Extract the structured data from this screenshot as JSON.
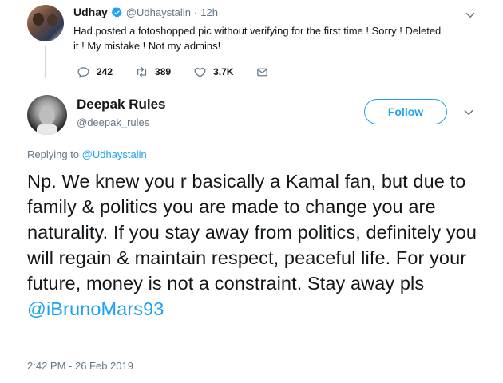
{
  "parent_tweet": {
    "name": "Udhay",
    "handle": "@Udhaystalin",
    "separator": "·",
    "time": "12h",
    "text": "Had posted a fotoshopped pic without verifying for the first time ! Sorry ! Deleted it ! My mistake ! Not my admins!",
    "replies": "242",
    "retweets": "389",
    "likes": "3.7K",
    "icons": [
      "reply-icon",
      "retweet-icon",
      "like-icon",
      "direct-message-icon",
      "verified-badge-icon",
      "chevron-down-icon"
    ]
  },
  "main_tweet": {
    "name": "Deepak Rules",
    "handle": "@deepak_rules",
    "follow_label": "Follow",
    "replying_prefix": "Replying to ",
    "replying_handle": "@Udhaystalin",
    "text": "Np. We knew you r basically a Kamal fan, but due to family & politics you are made to change you are naturality. If you stay away from politics, definitely you will regain & maintain respect, peaceful life. For your future, money is not a constraint. Stay away pls ",
    "mention": "@iBrunoMars93",
    "timestamp": "2:42 PM - 26 Feb 2019"
  },
  "colors": {
    "accent": "#1da1f2",
    "text": "#14171a",
    "secondary": "#657786",
    "thread_line": "#ccd6dd"
  }
}
